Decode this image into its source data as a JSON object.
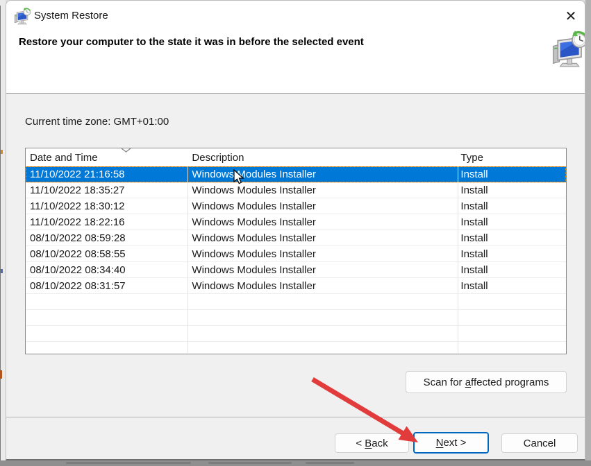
{
  "window": {
    "title": "System Restore",
    "icons": {
      "close": "✕",
      "app": "system-restore-computer-clock"
    }
  },
  "header": {
    "instruction": "Restore your computer to the state it was in before the selected event"
  },
  "content": {
    "timezone": "Current time zone: GMT+01:00"
  },
  "table": {
    "columns": {
      "date": "Date and Time",
      "description": "Description",
      "type": "Type"
    },
    "sorted_by": "Date and Time",
    "sort_direction": "descending",
    "selected_row_index": 0,
    "rows": [
      {
        "date": "11/10/2022 21:16:58",
        "description": "Windows Modules Installer",
        "type": "Install"
      },
      {
        "date": "11/10/2022 18:35:27",
        "description": "Windows Modules Installer",
        "type": "Install"
      },
      {
        "date": "11/10/2022 18:30:12",
        "description": "Windows Modules Installer",
        "type": "Install"
      },
      {
        "date": "11/10/2022 18:22:16",
        "description": "Windows Modules Installer",
        "type": "Install"
      },
      {
        "date": "08/10/2022 08:59:28",
        "description": "Windows Modules Installer",
        "type": "Install"
      },
      {
        "date": "08/10/2022 08:58:55",
        "description": "Windows Modules Installer",
        "type": "Install"
      },
      {
        "date": "08/10/2022 08:34:40",
        "description": "Windows Modules Installer",
        "type": "Install"
      },
      {
        "date": "08/10/2022 08:31:57",
        "description": "Windows Modules Installer",
        "type": "Install"
      }
    ]
  },
  "buttons": {
    "scan": {
      "pre": "Scan for ",
      "key": "a",
      "post": "ffected programs"
    },
    "back": {
      "pre": "< ",
      "key": "B",
      "post": "ack"
    },
    "next": {
      "pre": "",
      "key": "N",
      "post": "ext >"
    },
    "cancel": {
      "pre": "",
      "key": "",
      "post": "Cancel"
    }
  },
  "colors": {
    "selection_bg": "#0078d7",
    "selection_text": "#ffffff",
    "default_button_border": "#0067c0",
    "annotation_arrow_red": "#e23b3b"
  }
}
